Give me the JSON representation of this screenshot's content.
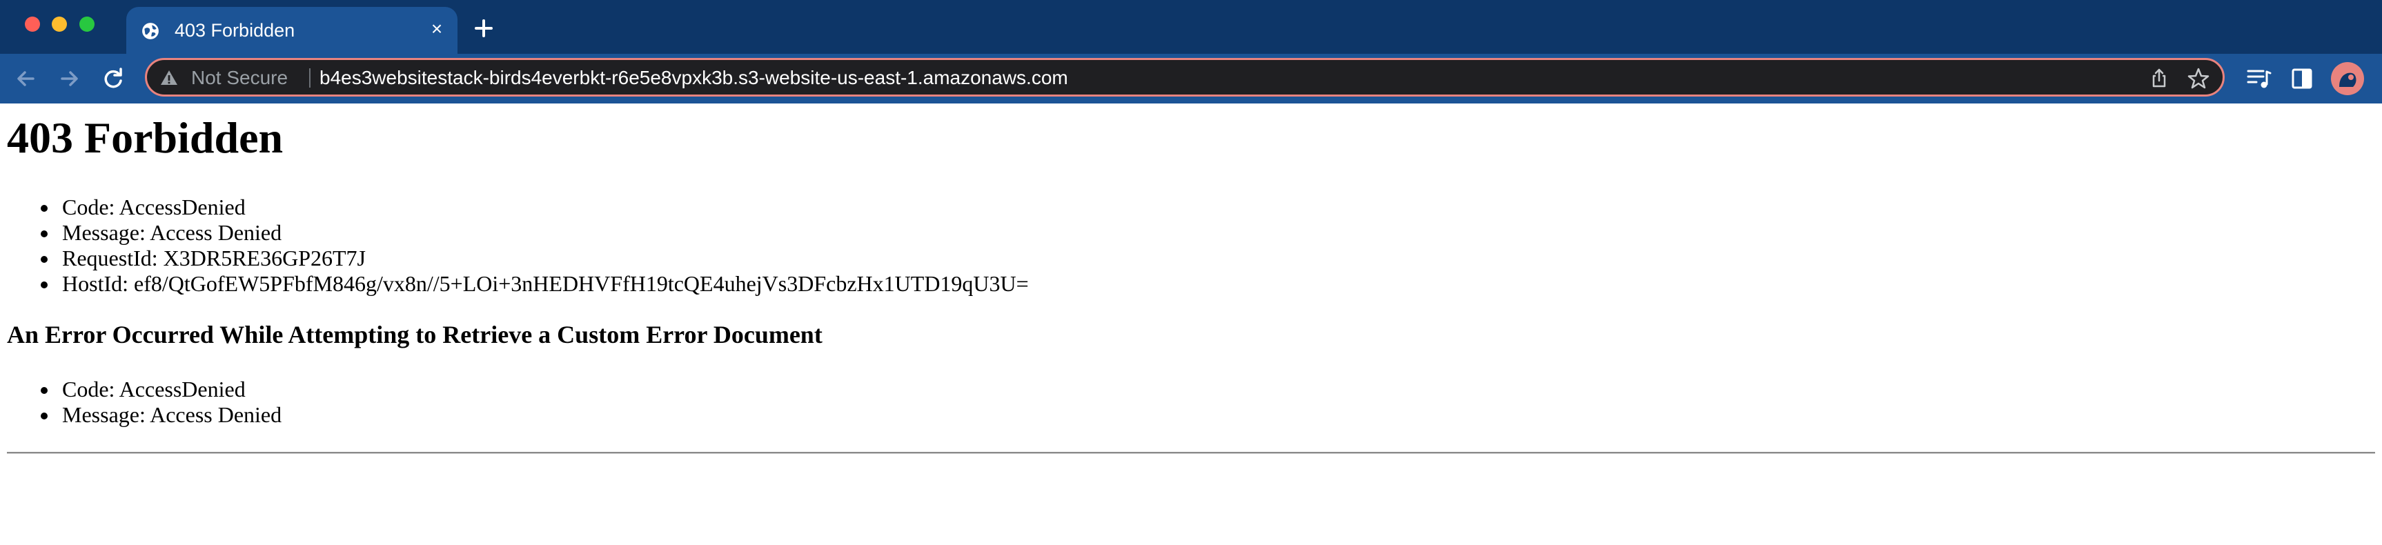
{
  "window": {
    "traffic_lights": {
      "close_color": "#ff5f57",
      "minimize_color": "#febc2e",
      "zoom_color": "#28c840"
    }
  },
  "tab": {
    "title": "403 Forbidden",
    "close_glyph": "×",
    "favicon": "globe-icon"
  },
  "new_tab": {
    "icon": "plus-icon"
  },
  "toolbar": {
    "back_icon": "arrow-left-icon",
    "forward_icon": "arrow-right-icon",
    "reload_icon": "reload-icon",
    "security_label": "Not Secure",
    "url": "b4es3websitestack-birds4everbkt-r6e5e8vpxk3b.s3-website-us-east-1.amazonaws.com",
    "omnibox_border_color": "#e8837e"
  },
  "page": {
    "heading": "403 Forbidden",
    "details": [
      "Code: AccessDenied",
      "Message: Access Denied",
      "RequestId: X3DR5RE36GP26T7J",
      "HostId: ef8/QtGofEW5PFbfM846g/vx8n//5+LOi+3nHEDHVFfH19tcQE4uhejVs3DFcbzHx1UTD19qU3U="
    ],
    "subheading": "An Error Occurred While Attempting to Retrieve a Custom Error Document",
    "sub_details": [
      "Code: AccessDenied",
      "Message: Access Denied"
    ]
  }
}
